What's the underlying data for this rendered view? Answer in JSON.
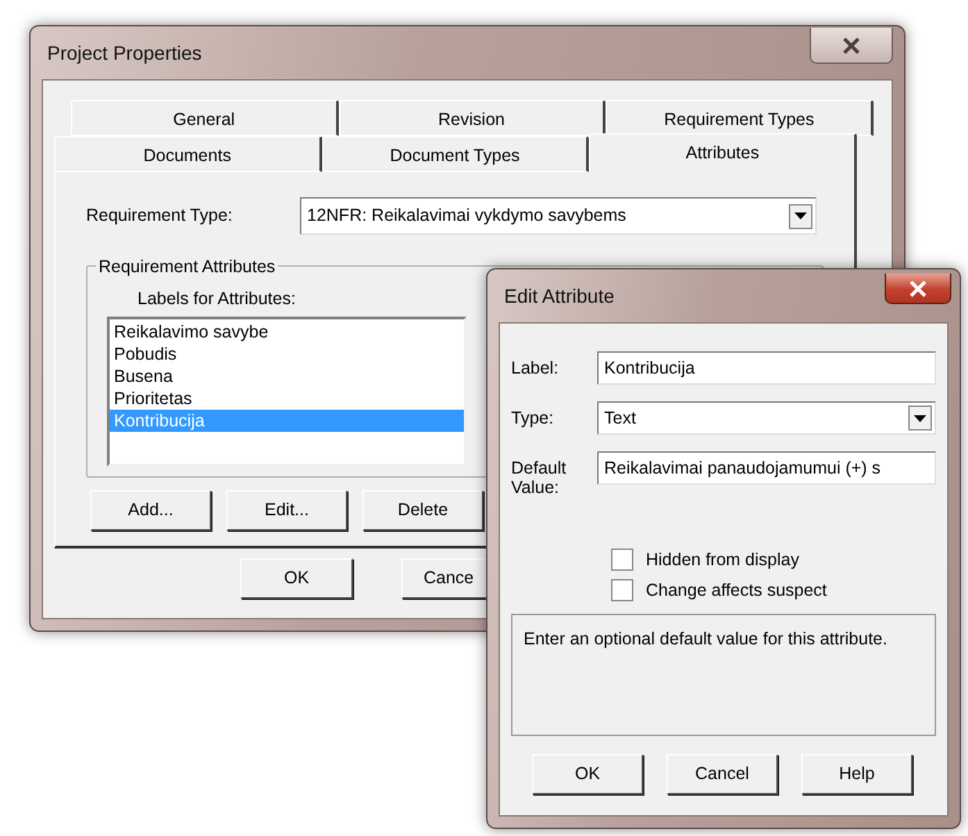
{
  "main_window": {
    "title": "Project Properties",
    "tab_rows": [
      [
        {
          "label": "General",
          "selected": false
        },
        {
          "label": "Revision",
          "selected": false
        },
        {
          "label": "Requirement Types",
          "selected": false
        }
      ],
      [
        {
          "label": "Documents",
          "selected": false
        },
        {
          "label": "Document Types",
          "selected": false
        },
        {
          "label": "Attributes",
          "selected": true
        }
      ]
    ],
    "requirement_type": {
      "label": "Requirement Type:",
      "value": "12NFR: Reikalavimai vykdymo savybems"
    },
    "group": {
      "title": "Requirement Attributes",
      "list_label": "Labels for Attributes:",
      "items": [
        {
          "label": "Reikalavimo savybe",
          "selected": false
        },
        {
          "label": "Pobudis",
          "selected": false
        },
        {
          "label": "Busena",
          "selected": false
        },
        {
          "label": "Prioritetas",
          "selected": false
        },
        {
          "label": "Kontribucija",
          "selected": true
        }
      ]
    },
    "buttons": [
      "Add...",
      "Edit...",
      "Delete"
    ],
    "footer_buttons": [
      "OK",
      "Cance"
    ]
  },
  "edit_dialog": {
    "title": "Edit Attribute",
    "fields": [
      {
        "kind": "text",
        "label": "Label:",
        "value": "Kontribucija"
      },
      {
        "kind": "select",
        "label": "Type:",
        "value": "Text"
      },
      {
        "kind": "text",
        "label": "Default Value:",
        "value": "Reikalavimai panaudojamumui (+) s"
      }
    ],
    "checkboxes": [
      {
        "label": "Hidden from display",
        "checked": false
      },
      {
        "label": "Change affects suspect",
        "checked": false
      }
    ],
    "description": "Enter an optional default value for this attribute.",
    "buttons": [
      "OK",
      "Cancel",
      "Help"
    ]
  }
}
